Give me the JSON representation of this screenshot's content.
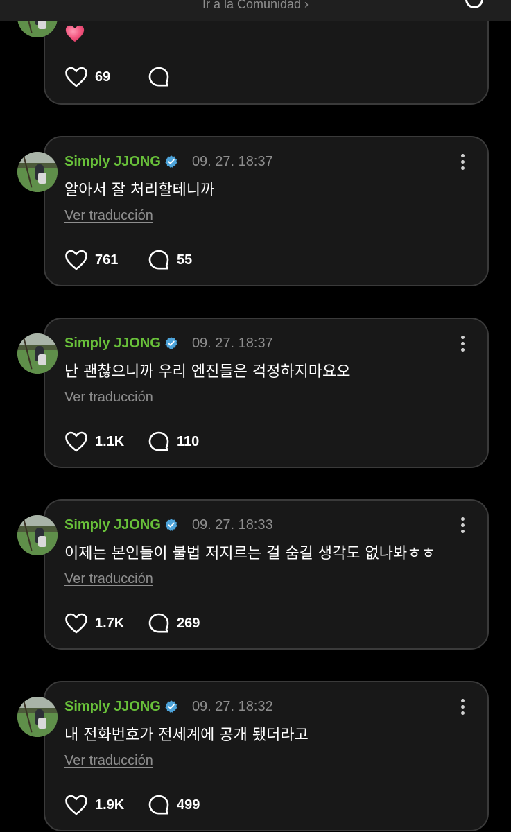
{
  "header": {
    "community_link": "Ir a la Comunidad ›"
  },
  "colors": {
    "background": "#000000",
    "card": "#181818",
    "card_border": "#3a3a3a",
    "username": "#69c13a",
    "muted": "#8e8e8e",
    "verified_badge": "#4da3d9"
  },
  "partial_post": {
    "content_emoji": "heart-emoji",
    "likes": "69",
    "comments": ""
  },
  "posts": [
    {
      "username": "Simply JJONG",
      "timestamp": "09. 27. 18:37",
      "text": "알아서 잘 처리할테니까",
      "translate": "Ver traducción",
      "likes": "761",
      "comments": "55"
    },
    {
      "username": "Simply JJONG",
      "timestamp": "09. 27. 18:37",
      "text": "난 괜찮으니까 우리 엔진들은 걱정하지마요오",
      "translate": "Ver traducción",
      "likes": "1.1K",
      "comments": "110"
    },
    {
      "username": "Simply JJONG",
      "timestamp": "09. 27. 18:33",
      "text": "이제는 본인들이 불법 저지르는 걸 숨길 생각도 없나봐ㅎㅎ",
      "translate": "Ver traducción",
      "likes": "1.7K",
      "comments": "269"
    },
    {
      "username": "Simply JJONG",
      "timestamp": "09. 27. 18:32",
      "text": "내 전화번호가 전세계에 공개 됐더라고",
      "translate": "Ver traducción",
      "likes": "1.9K",
      "comments": "499"
    }
  ]
}
